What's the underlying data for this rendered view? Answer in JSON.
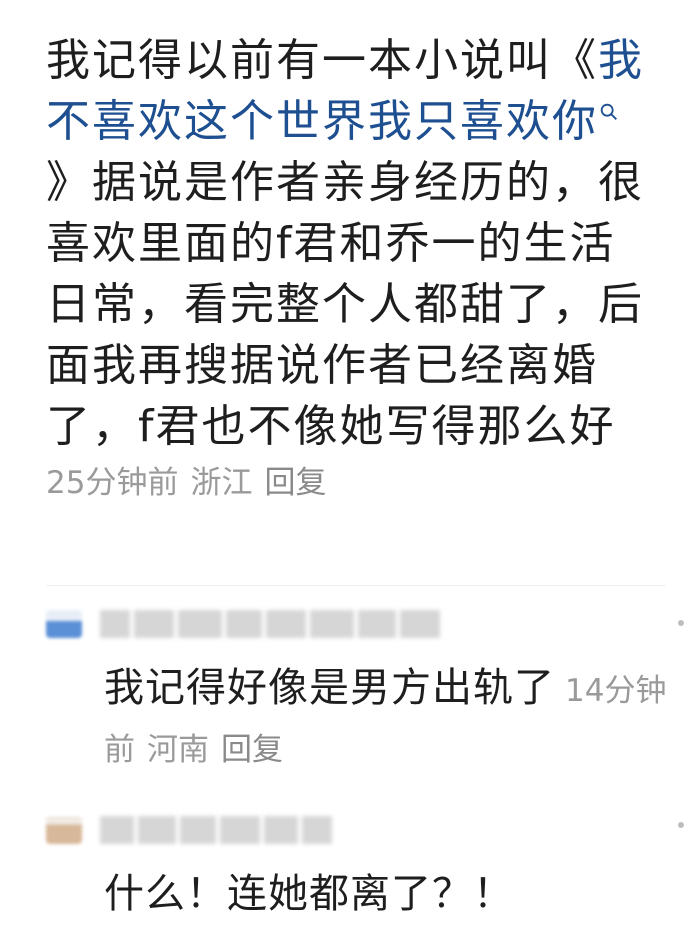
{
  "main_comment": {
    "text_before": "我记得以前有一本小说叫",
    "book_open": "《",
    "book_title": "我不喜欢这个世界我只喜欢你",
    "book_close": "》",
    "text_after": "据说是作者亲身经历的，很喜欢里面的f君和乔一的生活日常，看完整个人都甜了，后面我再搜据说作者已经离婚了，f君也不像她写得那么好",
    "time": "25分钟前",
    "location": "浙江",
    "reply_label": "回复"
  },
  "replies": [
    {
      "text": "我记得好像是男方出轨了",
      "time": "14分钟前",
      "location": "河南",
      "reply_label": "回复",
      "avatar_color": "#5b8fd6"
    },
    {
      "text": "什么！连她都离了？！",
      "avatar_color": "#d8b89a"
    }
  ],
  "colors": {
    "link": "#1d4f91",
    "meta": "#9a9a9a",
    "text": "#1e1e1e"
  }
}
